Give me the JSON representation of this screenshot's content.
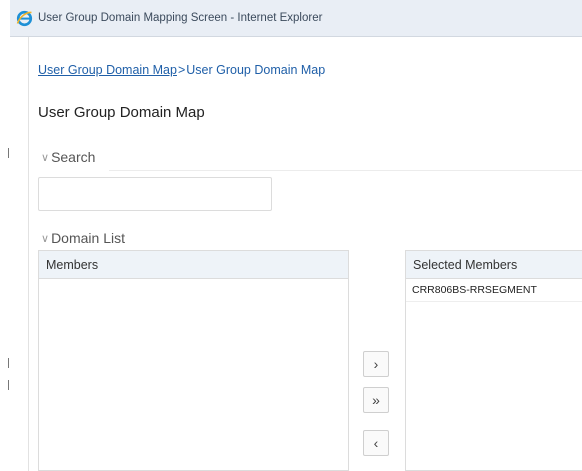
{
  "window": {
    "title": "User Group Domain Mapping Screen - Internet Explorer",
    "icon": "internet-explorer-icon",
    "accent_color": "#1e90d6"
  },
  "breadcrumb": {
    "items": [
      "User Group Domain Map",
      "User Group Domain Map"
    ],
    "separator": ">"
  },
  "page_title": "User Group Domain Map",
  "search_section": {
    "label": "Search",
    "input_value": "",
    "input_placeholder": ""
  },
  "domain_section": {
    "label": "Domain List",
    "members_header": "Members",
    "members": [],
    "selected_header": "Selected Members",
    "selected_members": [
      "CRR806BS-RRSEGMENT"
    ]
  },
  "move_buttons": [
    {
      "glyph": "›",
      "name": "move-selected-right-button"
    },
    {
      "glyph": "»",
      "name": "move-all-right-button"
    },
    {
      "glyph": "‹",
      "name": "move-selected-left-button"
    }
  ]
}
